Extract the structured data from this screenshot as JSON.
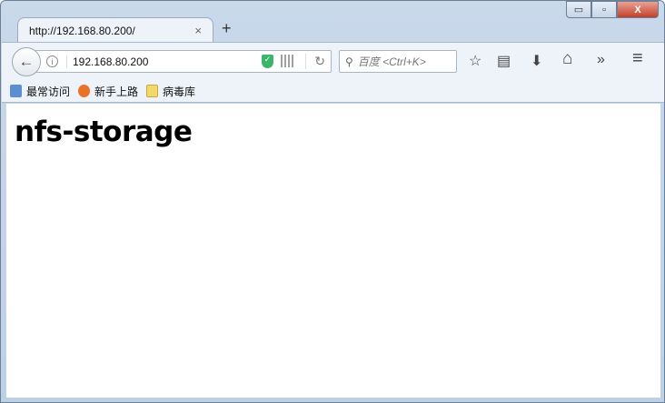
{
  "window": {
    "minimize": "▭",
    "restore": "▫",
    "close": "X"
  },
  "tab": {
    "title": "http://192.168.80.200/",
    "close": "×",
    "new_tab": "+"
  },
  "nav": {
    "back": "←",
    "url": "192.168.80.200",
    "info": "i",
    "reload": "↻",
    "search_placeholder": "百度 <Ctrl+K>",
    "search_icon": "⚲",
    "tools": {
      "bookmark": "☆",
      "reading_list": "▤",
      "download": "⬇",
      "home": "⌂",
      "overflow": "»",
      "menu": "≡"
    }
  },
  "bookmarks": [
    {
      "label": "最常访问",
      "icon": "most-visited-icon",
      "color": "#5b8fd1"
    },
    {
      "label": "新手上路",
      "icon": "firefox-icon",
      "color": "#e8722a"
    },
    {
      "label": "病毒库",
      "icon": "folder-icon",
      "color": "#f2d76a"
    }
  ],
  "page": {
    "heading": "nfs-storage"
  }
}
